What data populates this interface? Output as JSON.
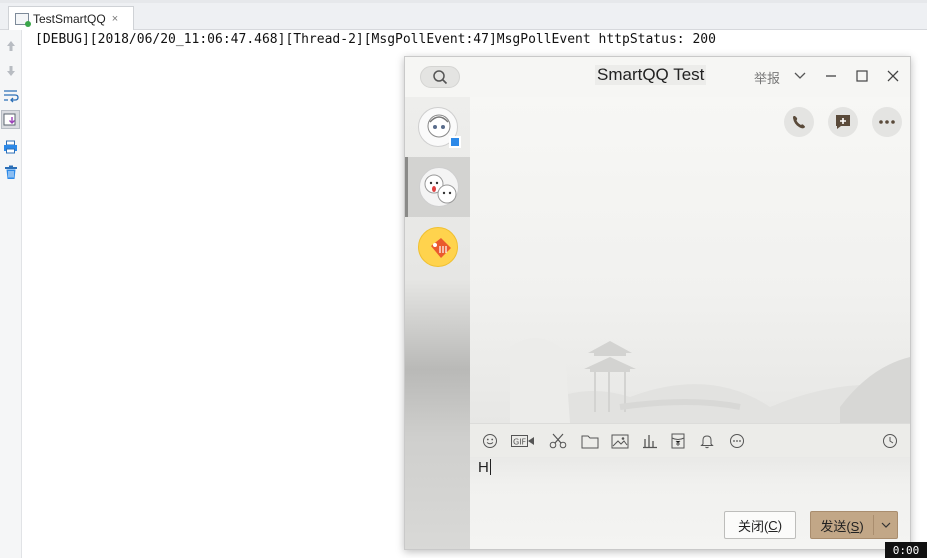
{
  "ide": {
    "tab_label": "TestSmartQQ",
    "tab_close": "×",
    "console_line": "[DEBUG][2018/06/20_11:06:47.468][Thread-2][MsgPollEvent:47]MsgPollEvent httpStatus: 200",
    "gutter_icons": [
      "arrow-up-icon",
      "arrow-down-icon",
      "soft-wrap-icon",
      "scroll-to-end-icon",
      "print-icon",
      "trash-icon"
    ]
  },
  "qq": {
    "title": "SmartQQ Test",
    "report_label": "举报",
    "contacts": [
      "contact-avatar-1",
      "contact-avatar-2",
      "contact-avatar-3"
    ],
    "action_icons": [
      "phone-icon",
      "add-message-icon",
      "more-icon"
    ],
    "toolbar_icons": [
      "emoji-icon",
      "gif-icon",
      "scissors-icon",
      "folder-icon",
      "image-icon",
      "bar-chart-icon",
      "red-packet-icon",
      "bell-icon",
      "more-circle-icon",
      "clock-icon"
    ],
    "input_value": "H",
    "close_button": {
      "text": "关闭(",
      "key": "C",
      "tail": ")"
    },
    "send_button": {
      "text": "发送(",
      "key": "S",
      "tail": ")"
    }
  },
  "timer": "0:00",
  "colors": {
    "send_button": "#c2a787",
    "accent_blue": "#2c89e8"
  }
}
